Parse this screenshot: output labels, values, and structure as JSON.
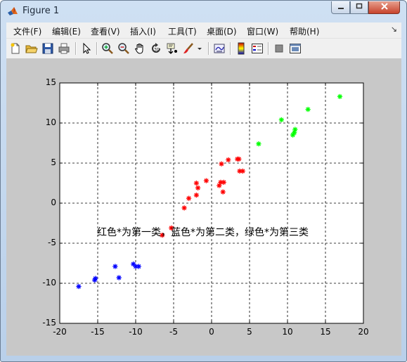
{
  "window": {
    "title": "Figure 1",
    "controls": [
      "minimize",
      "maximize",
      "close"
    ]
  },
  "menu": {
    "items": [
      "文件(F)",
      "编辑(E)",
      "查看(V)",
      "插入(I)",
      "工具(T)",
      "桌面(D)",
      "窗口(W)",
      "帮助(H)"
    ],
    "dock_arrow": "↘"
  },
  "toolbar": {
    "icons": [
      "new-figure-icon",
      "open-file-icon",
      "save-icon",
      "print-icon",
      "edit-plot-arrow-icon",
      "zoom-in-icon",
      "zoom-out-icon",
      "pan-hand-icon",
      "rotate-3d-icon",
      "data-cursor-icon",
      "brush-icon",
      "brush-dropdown-icon",
      "link-plot-icon",
      "colorbar-icon",
      "legend-icon",
      "hide-plot-tools-icon",
      "show-plot-tools-icon"
    ]
  },
  "chart_data": {
    "type": "scatter",
    "title": "",
    "xlabel": "",
    "ylabel": "",
    "xlim": [
      -20,
      20
    ],
    "ylim": [
      -15,
      15
    ],
    "xticks": [
      "-20",
      "-15",
      "-10",
      "-5",
      "0",
      "5",
      "10",
      "15",
      "20"
    ],
    "yticks": [
      "15",
      "10",
      "5",
      "0",
      "-5",
      "-10",
      "-15"
    ],
    "grid": true,
    "marker": "*",
    "annotation": "红色*为第一类，蓝色*为第二类，绿色*为第三类",
    "colors": {
      "red": "#ff0000",
      "blue": "#0000ff",
      "green": "#00ff00"
    },
    "series": [
      {
        "color": "red",
        "points": [
          [
            -6.5,
            -4.0
          ],
          [
            -5.3,
            -3.1
          ],
          [
            -3.6,
            -0.6
          ],
          [
            -3.0,
            0.6
          ],
          [
            -2.0,
            1.0
          ],
          [
            -1.8,
            1.9
          ],
          [
            -2.0,
            2.5
          ],
          [
            -0.7,
            2.8
          ],
          [
            1.0,
            2.2
          ],
          [
            1.2,
            2.6
          ],
          [
            1.6,
            2.6
          ],
          [
            1.5,
            1.4
          ],
          [
            1.3,
            4.9
          ],
          [
            2.2,
            5.4
          ],
          [
            3.4,
            5.5
          ],
          [
            3.6,
            5.5
          ],
          [
            3.7,
            4.0
          ],
          [
            4.1,
            4.0
          ]
        ]
      },
      {
        "color": "blue",
        "points": [
          [
            -17.5,
            -10.4
          ],
          [
            -15.4,
            -9.6
          ],
          [
            -15.3,
            -9.4
          ],
          [
            -12.7,
            -7.9
          ],
          [
            -12.2,
            -9.3
          ],
          [
            -10.3,
            -7.6
          ],
          [
            -10.0,
            -7.9
          ],
          [
            -9.6,
            -7.9
          ]
        ]
      },
      {
        "color": "green",
        "points": [
          [
            6.2,
            7.4
          ],
          [
            9.2,
            10.4
          ],
          [
            10.7,
            8.5
          ],
          [
            10.9,
            8.8
          ],
          [
            11.0,
            9.2
          ],
          [
            12.7,
            11.7
          ],
          [
            16.9,
            13.3
          ]
        ]
      }
    ]
  }
}
